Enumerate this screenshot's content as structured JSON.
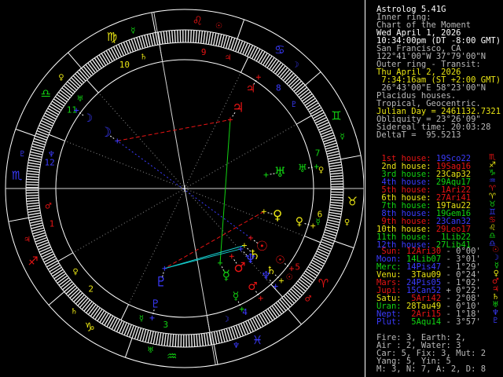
{
  "colors": {
    "red": "#e81414",
    "yellow": "#e8e414",
    "green": "#12d412",
    "blue": "#3b3bff",
    "cyan": "#14cdcd",
    "white": "#ffffff",
    "gray": "#b9b9b9"
  },
  "panel": {
    "title": "Astrolog 5.41G",
    "info": [
      {
        "t": "Inner ring:",
        "c": "gray"
      },
      {
        "t": "Chart of the Moment",
        "c": "gray"
      },
      {
        "t": "Wed April 1, 2026",
        "c": "white"
      },
      {
        "t": "10:34:00pm (DT -8:00 GMT)",
        "c": "white"
      },
      {
        "t": "San Francisco, CA",
        "c": "gray"
      },
      {
        "t": "122°41'00\"W 37°79'00\"N",
        "c": "gray"
      },
      {
        "t": "Outer ring - Transit:",
        "c": "gray"
      },
      {
        "t": "Thu April 2, 2026",
        "c": "yellow"
      },
      {
        "t": " 7:34:16am (ST +2:00 GMT)",
        "c": "yellow"
      },
      {
        "t": " 26°43'00\"E 58°23'00\"N",
        "c": "gray"
      },
      {
        "t": "Placidus houses.",
        "c": "gray"
      },
      {
        "t": "Tropical, Geocentric.",
        "c": "gray"
      },
      {
        "t": "Julian Day = 2461132.7321",
        "c": "yellow"
      },
      {
        "t": "Obliquity = 23°26'09\"",
        "c": "gray"
      },
      {
        "t": "Sidereal time: 20:03:28",
        "c": "gray"
      },
      {
        "t": "DeltaT =  95.5213",
        "c": "gray"
      }
    ],
    "houses": [
      {
        "label": " 1st house:",
        "lc": "red",
        "value": "19Sco22",
        "vc": "blue",
        "glyph": "♏",
        "gc": "red"
      },
      {
        "label": " 2nd house:",
        "lc": "yellow",
        "value": "19Sag16",
        "vc": "red",
        "glyph": "♐",
        "gc": "yellow"
      },
      {
        "label": " 3rd house:",
        "lc": "green",
        "value": "23Cap32",
        "vc": "yellow",
        "glyph": "♑",
        "gc": "green"
      },
      {
        "label": " 4th house:",
        "lc": "blue",
        "value": "29Aqu17",
        "vc": "green",
        "glyph": "♒",
        "gc": "blue"
      },
      {
        "label": " 5th house:",
        "lc": "red",
        "value": " 1Ari22",
        "vc": "red",
        "glyph": "♈",
        "gc": "red"
      },
      {
        "label": " 6th house:",
        "lc": "yellow",
        "value": "27Ari41",
        "vc": "red",
        "glyph": "♈",
        "gc": "yellow"
      },
      {
        "label": " 7th house:",
        "lc": "green",
        "value": "19Tau22",
        "vc": "yellow",
        "glyph": "♉",
        "gc": "green"
      },
      {
        "label": " 8th house:",
        "lc": "blue",
        "value": "19Gem16",
        "vc": "green",
        "glyph": "♊",
        "gc": "blue"
      },
      {
        "label": " 9th house:",
        "lc": "red",
        "value": "23Can32",
        "vc": "blue",
        "glyph": "♋",
        "gc": "red"
      },
      {
        "label": "10th house:",
        "lc": "yellow",
        "value": "29Leo17",
        "vc": "red",
        "glyph": "♌",
        "gc": "yellow"
      },
      {
        "label": "11th house:",
        "lc": "green",
        "value": " 1Lib22",
        "vc": "green",
        "glyph": "♎",
        "gc": "green"
      },
      {
        "label": "12th house:",
        "lc": "blue",
        "value": "27Lib41",
        "vc": "green",
        "glyph": "♎",
        "gc": "blue"
      }
    ],
    "planets": [
      {
        "label": " Sun:",
        "lc": "red",
        "value": "12Ari30",
        "vc": "red",
        "vel": "- 0°00'",
        "glyph": "☉",
        "gc": "red"
      },
      {
        "label": "Moon:",
        "lc": "blue",
        "value": "14Lib07",
        "vc": "green",
        "vel": "- 3°01'",
        "glyph": "☽",
        "gc": "blue"
      },
      {
        "label": "Merc:",
        "lc": "green",
        "value": "14Pis47",
        "vc": "blue",
        "vel": "- 1°29'",
        "glyph": "☿",
        "gc": "green"
      },
      {
        "label": "Venu:",
        "lc": "yellow",
        "value": " 3Tau09",
        "vc": "yellow",
        "vel": "- 0°24'",
        "glyph": "♀",
        "gc": "yellow"
      },
      {
        "label": "Mars:",
        "lc": "red",
        "value": "24Pis05",
        "vc": "blue",
        "vel": "- 1°02'",
        "glyph": "♂",
        "gc": "red"
      },
      {
        "label": "Jupi:",
        "lc": "red",
        "value": "15Can52",
        "vc": "blue",
        "vel": "+ 0°22'",
        "glyph": "♃",
        "gc": "red"
      },
      {
        "label": "Satu:",
        "lc": "yellow",
        "value": " 5Ari42",
        "vc": "red",
        "vel": "- 2°08'",
        "glyph": "♄",
        "gc": "yellow"
      },
      {
        "label": "Uran:",
        "lc": "green",
        "value": "28Tau49",
        "vc": "yellow",
        "vel": "- 0°10'",
        "glyph": "♅",
        "gc": "green"
      },
      {
        "label": "Nept:",
        "lc": "blue",
        "value": " 2Ari15",
        "vc": "red",
        "vel": "- 1°18'",
        "glyph": "♆",
        "gc": "blue"
      },
      {
        "label": "Plut:",
        "lc": "blue",
        "value": " 5Aqu14",
        "vc": "green",
        "vel": "- 3°57'",
        "glyph": "♇",
        "gc": "blue"
      }
    ],
    "stats": [
      "Fire: 3, Earth: 2,",
      "Air : 2, Water: 3",
      "Car: 5, Fix: 3, Mut: 2",
      "Yang: 5, Yin: 5",
      "M: 3, N: 7, A: 2, D: 8"
    ]
  },
  "wheel": {
    "asc_lon": 229.367,
    "house_cusps": [
      229.367,
      259.267,
      293.533,
      329.283,
      1.367,
      27.683,
      49.367,
      79.267,
      113.533,
      149.283,
      181.367,
      207.683
    ],
    "signs": [
      {
        "glyph": "♈",
        "color": "red",
        "ruler": "♂",
        "rc": "red"
      },
      {
        "glyph": "♉",
        "color": "yellow",
        "ruler": "♀",
        "rc": "yellow"
      },
      {
        "glyph": "♊",
        "color": "green",
        "ruler": "☿",
        "rc": "green"
      },
      {
        "glyph": "♋",
        "color": "blue",
        "ruler": "☽",
        "rc": "blue"
      },
      {
        "glyph": "♌",
        "color": "red",
        "ruler": "☉",
        "rc": "red"
      },
      {
        "glyph": "♍",
        "color": "yellow",
        "ruler": "☿",
        "rc": "green"
      },
      {
        "glyph": "♎",
        "color": "green",
        "ruler": "♀",
        "rc": "yellow"
      },
      {
        "glyph": "♏",
        "color": "blue",
        "ruler": "♇",
        "rc": "blue"
      },
      {
        "glyph": "♐",
        "color": "red",
        "ruler": "♃",
        "rc": "red"
      },
      {
        "glyph": "♑",
        "color": "yellow",
        "ruler": "♄",
        "rc": "yellow"
      },
      {
        "glyph": "♒",
        "color": "green",
        "ruler": "♅",
        "rc": "green"
      },
      {
        "glyph": "♓",
        "color": "blue",
        "ruler": "♆",
        "rc": "blue"
      }
    ],
    "house_number_colors": [
      "red",
      "yellow",
      "green",
      "blue",
      "red",
      "yellow",
      "green",
      "blue",
      "red",
      "yellow",
      "green",
      "blue"
    ],
    "planets": [
      {
        "name": "sun",
        "glyph": "☉",
        "color": "red",
        "natal": 12.508,
        "transit": 12.47
      },
      {
        "name": "moon",
        "glyph": "☽",
        "color": "blue",
        "natal": 194.117,
        "transit": 193.56
      },
      {
        "name": "mercury",
        "glyph": "☿",
        "color": "green",
        "natal": 344.783,
        "transit": 344.72
      },
      {
        "name": "venus",
        "glyph": "♀",
        "color": "yellow",
        "natal": 33.15,
        "transit": 33.1
      },
      {
        "name": "mars",
        "glyph": "♂",
        "color": "red",
        "natal": 354.083,
        "transit": 354.04
      },
      {
        "name": "jupiter",
        "glyph": "♃",
        "color": "red",
        "natal": 105.867,
        "transit": 105.85
      },
      {
        "name": "saturn",
        "glyph": "♄",
        "color": "yellow",
        "natal": 5.7,
        "transit": 5.69
      },
      {
        "name": "uranus",
        "glyph": "♅",
        "color": "green",
        "natal": 58.817,
        "transit": 58.8
      },
      {
        "name": "neptune",
        "glyph": "♆",
        "color": "blue",
        "natal": 2.25,
        "transit": 2.24
      },
      {
        "name": "pluto",
        "glyph": "♇",
        "color": "blue",
        "natal": 305.233,
        "transit": 305.23
      }
    ],
    "aspects": [
      {
        "a": "sun",
        "b": "moon",
        "type": "opposition",
        "color": "blue",
        "dash": "2,3"
      },
      {
        "a": "moon",
        "b": "jupiter",
        "type": "square",
        "color": "red",
        "dash": "5,3"
      },
      {
        "a": "venus",
        "b": "pluto",
        "type": "square",
        "color": "red",
        "dash": "5,3"
      },
      {
        "a": "mercury",
        "b": "jupiter",
        "type": "trine",
        "color": "green",
        "dash": ""
      },
      {
        "a": "pluto",
        "b": "saturn",
        "type": "sextile",
        "color": "cyan",
        "dash": ""
      },
      {
        "a": "pluto",
        "b": "neptune",
        "type": "sextile",
        "color": "cyan",
        "dash": ""
      }
    ]
  }
}
